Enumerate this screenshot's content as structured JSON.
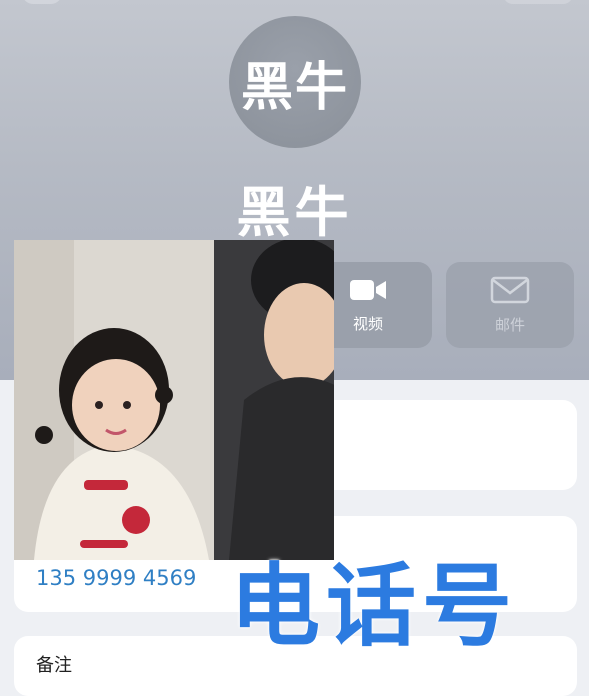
{
  "contact": {
    "avatar_text": "黑牛",
    "name": "黑牛"
  },
  "actions": [
    {
      "label": "视频",
      "icon": "video-camera-icon"
    },
    {
      "label": "邮件",
      "icon": "mail-icon"
    }
  ],
  "phone": {
    "number": "135 9999 4569"
  },
  "notes": {
    "label": "备注"
  },
  "overlay": {
    "caption": "电话号"
  },
  "colors": {
    "accent_blue": "#2c7be0",
    "link_blue": "#2f7fc4",
    "header_gray": "#b5bac4"
  }
}
